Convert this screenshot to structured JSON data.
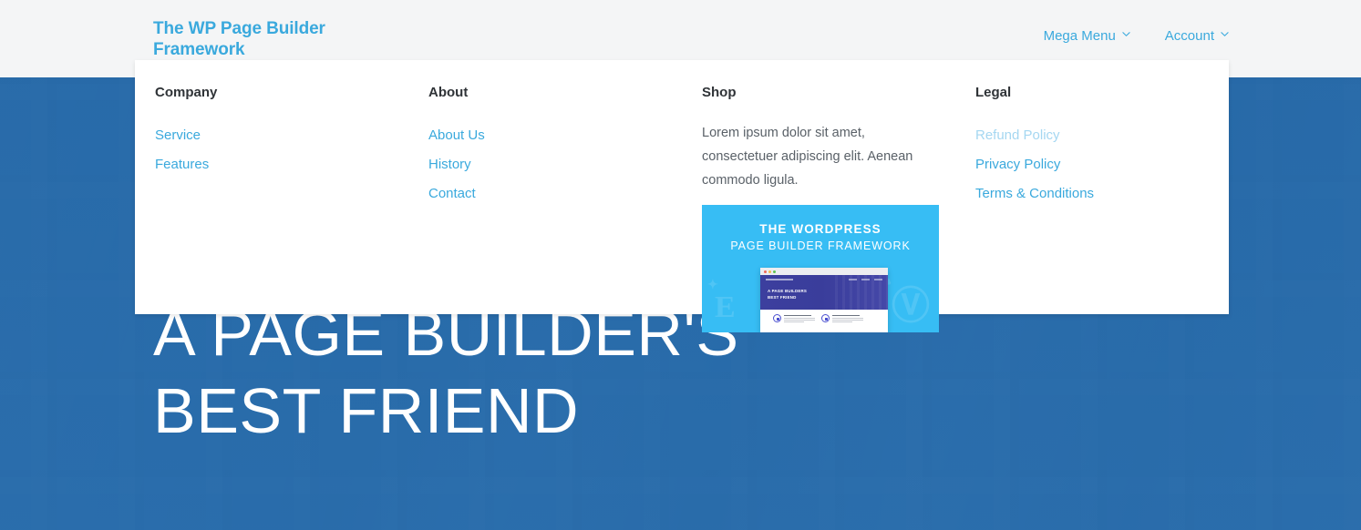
{
  "header": {
    "brand": "The WP Page Builder Framework",
    "nav": [
      {
        "label": "Mega Menu",
        "icon": "chevron-down-icon",
        "expanded": true
      },
      {
        "label": "Account",
        "icon": "chevron-down-icon",
        "expanded": false
      }
    ]
  },
  "mega_menu": {
    "visible": true,
    "columns": [
      {
        "title": "Company",
        "links": [
          {
            "label": "Service",
            "state": "normal"
          },
          {
            "label": "Features",
            "state": "normal"
          }
        ]
      },
      {
        "title": "About",
        "links": [
          {
            "label": "About Us",
            "state": "normal"
          },
          {
            "label": "History",
            "state": "normal"
          },
          {
            "label": "Contact",
            "state": "normal"
          }
        ]
      },
      {
        "title": "Shop",
        "text": "Lorem ipsum dolor sit amet, consectetuer adipiscing elit. Aenean commodo ligula.",
        "promo": {
          "line1": "THE WORDPRESS",
          "line2": "PAGE BUILDER FRAMEWORK",
          "mockup_heading": "A PAGE BUILDERS\nBEST FRIEND",
          "background_color": "#37bdf4"
        }
      },
      {
        "title": "Legal",
        "links": [
          {
            "label": "Refund Policy",
            "state": "hovered"
          },
          {
            "label": "Privacy Policy",
            "state": "normal"
          },
          {
            "label": "Terms & Conditions",
            "state": "normal"
          }
        ]
      }
    ]
  },
  "hero": {
    "title": "A PAGE BUILDER'S\nBEST FRIEND",
    "overlay_color": "#2c6aa8"
  },
  "colors": {
    "link_blue": "#3aa9dd",
    "link_blue_hover": "#a5d7f1",
    "header_bg": "#f4f5f6",
    "heading_dark": "#2f3337",
    "body_text": "#5a6168",
    "hero_blue": "#2b6cb0"
  }
}
